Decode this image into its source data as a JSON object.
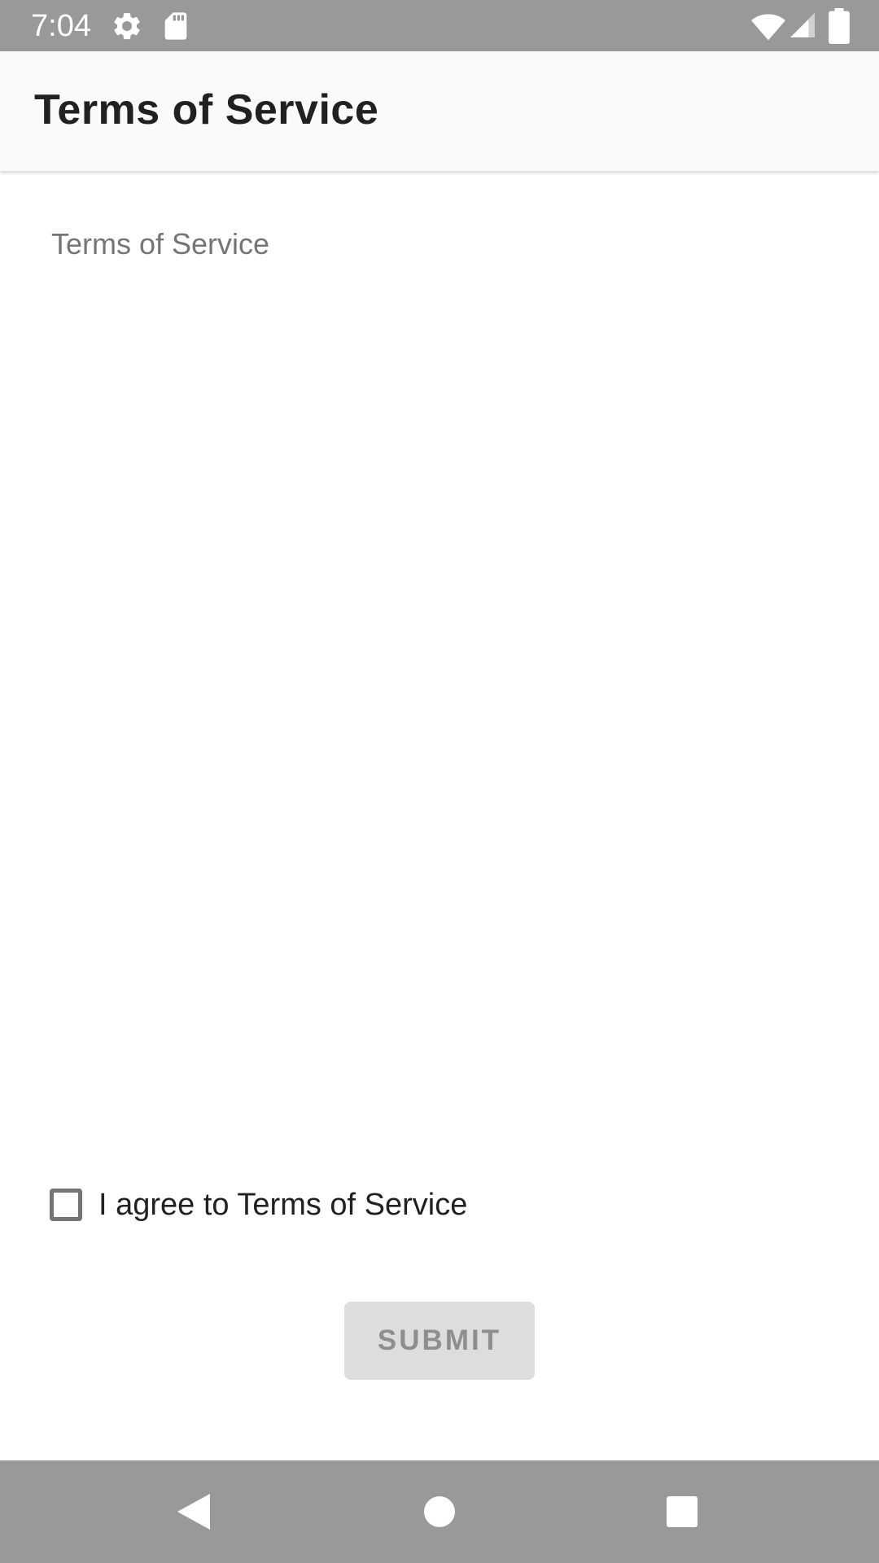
{
  "status_bar": {
    "time": "7:04",
    "icons": [
      "gear-icon",
      "sd-card-icon",
      "wifi-icon",
      "cell-signal-icon",
      "battery-icon"
    ]
  },
  "app_bar": {
    "title": "Terms of Service"
  },
  "content": {
    "terms_text": "Terms of Service"
  },
  "agreement": {
    "label": "I agree to Terms of Service",
    "checked": false
  },
  "submit": {
    "label": "SUBMIT",
    "enabled": false
  },
  "nav_bar": {
    "buttons": [
      "back-icon",
      "home-icon",
      "recents-icon"
    ]
  },
  "colors": {
    "system_bars": "#999999",
    "app_bar": "#fafafa",
    "button_disabled_bg": "#dddddd",
    "button_disabled_text": "#8e8e8e"
  }
}
